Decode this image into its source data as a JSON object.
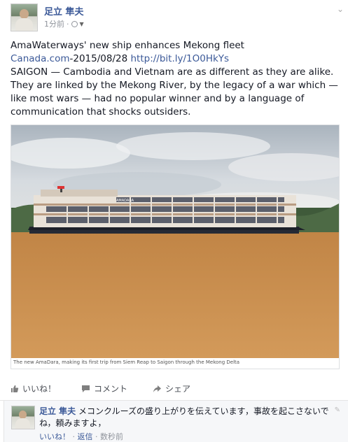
{
  "post": {
    "author": "足立 隼夫",
    "time": "1分前",
    "dot": "·",
    "article_title": "AmaWaterways' new ship enhances Mekong fleet",
    "source": "Canada.com",
    "date": "-2015/08/28 ",
    "short_url": "http://bit.ly/1O0HkYs",
    "body": "SAIGON — Cambodia and Vietnam are as different as they are alike. They are linked by the Mekong River, by the legacy of a war which — like most wars — had no popular winner and by a language of communication that shocks outsiders.",
    "photo_caption": "The new AmaDara, making its first trip from Siem Reap to Saigon through the Mekong Delta",
    "ship_name": "AMADARA"
  },
  "actions": {
    "like": "いいね！",
    "comment": "コメント",
    "share": "シェア"
  },
  "comment": {
    "author": "足立 隼夫",
    "text": "メコンクルーズの盛り上がりを伝えています，事故を起こさないでね，頼みますよ，",
    "like": "いいね！",
    "dot1": "·",
    "reply": "返信",
    "dot2": "·",
    "time": "数秒前"
  },
  "icons": {
    "chevron": "chevron-down-icon",
    "globe": "globe-icon",
    "like": "thumbs-up-icon",
    "comment": "comment-icon",
    "share": "share-icon",
    "edit": "pencil-icon"
  },
  "colors": {
    "link": "#3b5998",
    "meta": "#90949c",
    "river": "#c9904e",
    "sky": "#c6cdd4"
  }
}
